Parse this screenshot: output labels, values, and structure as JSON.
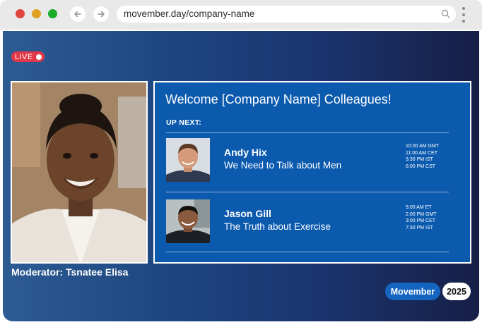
{
  "browser": {
    "url": "movember.day/company-name",
    "back_icon": "arrow-left-icon",
    "forward_icon": "arrow-right-icon",
    "search_icon": "search-icon",
    "menu_icon": "kebab-menu-icon"
  },
  "stream": {
    "live_label": "LIVE",
    "moderator": "Moderator: Tsnatee Elisa"
  },
  "panel": {
    "title": "Welcome [Company Name] Colleagues!",
    "up_next": "UP NEXT:",
    "sessions": [
      {
        "speaker": "Andy Hix",
        "talk": "We Need to Talk about Men",
        "times": [
          "10:00 AM GMT",
          "11:00 AM CET",
          "3:30 PM IST",
          "6:00 PM CST"
        ]
      },
      {
        "speaker": "Jason Gill",
        "talk": "The Truth about Exercise",
        "times": [
          "9:00 AM ET",
          "2:00 PM GMT",
          "3:00 PM CET",
          "7:30 PM IST"
        ]
      }
    ]
  },
  "badges": {
    "month": "Movember",
    "year": "2025"
  },
  "colors": {
    "live": "#e23746",
    "panel": "#0b5aae",
    "month_badge": "#1565c0"
  }
}
